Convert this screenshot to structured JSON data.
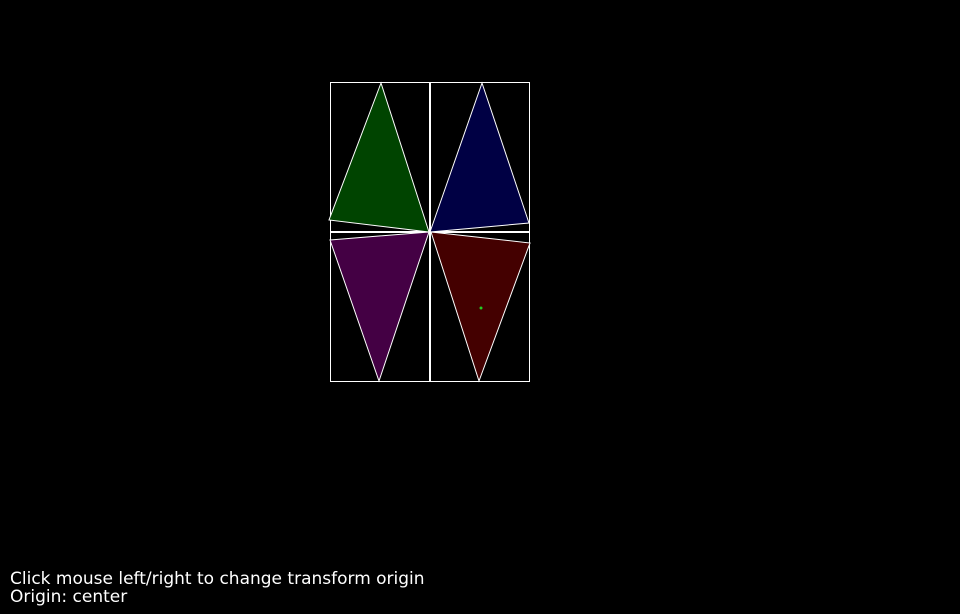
{
  "colors": {
    "background": "#000000",
    "outline": "#ffffff",
    "green": "#004400",
    "blue": "#000044",
    "purple": "#440044",
    "red": "#440000",
    "marker": "#22cc22"
  },
  "instructions": {
    "line1": "Click mouse left/right to change transform origin",
    "line2": "Origin: center"
  }
}
